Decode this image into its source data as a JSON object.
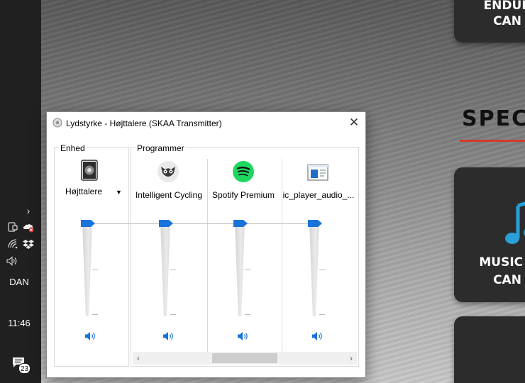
{
  "taskbar": {
    "language": "DAN",
    "time": "11:46",
    "notification_count": "23",
    "chevron": "›"
  },
  "webpage": {
    "card_top_line1": "ENDUR",
    "card_top_line2": "CAN",
    "heading": "SPEC",
    "card_middle_line1": "MUSIC T",
    "card_middle_line2": "CAN",
    "accent_color": "#d23a2a",
    "note_color": "#2a9fd8"
  },
  "dialog": {
    "title": "Lydstyrke - Højttalere (SKAA Transmitter)",
    "close_glyph": "✕",
    "device_group_label": "Enhed",
    "apps_group_label": "Programmer",
    "device": {
      "name": "Højttalere",
      "icon": "speaker-device-icon",
      "volume": 100
    },
    "apps": [
      {
        "name": "Intelligent Cycling",
        "icon": "owl-icon",
        "volume": 100
      },
      {
        "name": "Spotify Premium",
        "icon": "spotify-icon",
        "volume": 100
      },
      {
        "name": "ic_player_audio_...",
        "icon": "window-app-icon",
        "volume": 100
      }
    ],
    "scroll_left": "‹",
    "scroll_right": "›",
    "slider_color": "#1a73d9"
  }
}
